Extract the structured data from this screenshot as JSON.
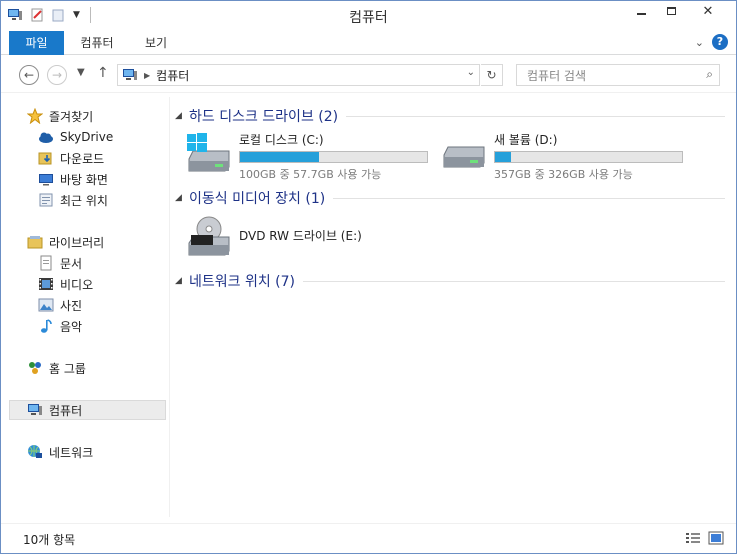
{
  "window": {
    "title": "컴퓨터"
  },
  "ribbon": {
    "tabs": [
      {
        "label": "파일"
      },
      {
        "label": "컴퓨터"
      },
      {
        "label": "보기"
      }
    ]
  },
  "address": {
    "crumb": "컴퓨터"
  },
  "search": {
    "placeholder": "컴퓨터 검색"
  },
  "navpane": {
    "favorites": {
      "label": "즐겨찾기",
      "items": [
        "SkyDrive",
        "다운로드",
        "바탕 화면",
        "최근 위치"
      ]
    },
    "libraries": {
      "label": "라이브러리",
      "items": [
        "문서",
        "비디오",
        "사진",
        "음악"
      ]
    },
    "homegroup": "홈 그룹",
    "computer": "컴퓨터",
    "network": "네트워크"
  },
  "groups": {
    "hdd": {
      "title": "하드 디스크 드라이브 (2)"
    },
    "removable": {
      "title": "이동식 미디어 장치 (1)"
    },
    "network": {
      "title": "네트워크 위치 (7)"
    }
  },
  "drives": {
    "c": {
      "name": "로컬 디스크 (C:)",
      "free": "100GB 중 57.7GB 사용 가능",
      "used_fraction": 0.423
    },
    "d": {
      "name": "새 볼륨 (D:)",
      "free": "357GB 중 326GB 사용 가능",
      "used_fraction": 0.087
    },
    "e": {
      "name": "DVD RW 드라이브 (E:)"
    }
  },
  "status": {
    "count": "10개 항목"
  },
  "colors": {
    "accent": "#1979ca",
    "bar_fill": "#26a0da",
    "group_title": "#1e3287"
  }
}
